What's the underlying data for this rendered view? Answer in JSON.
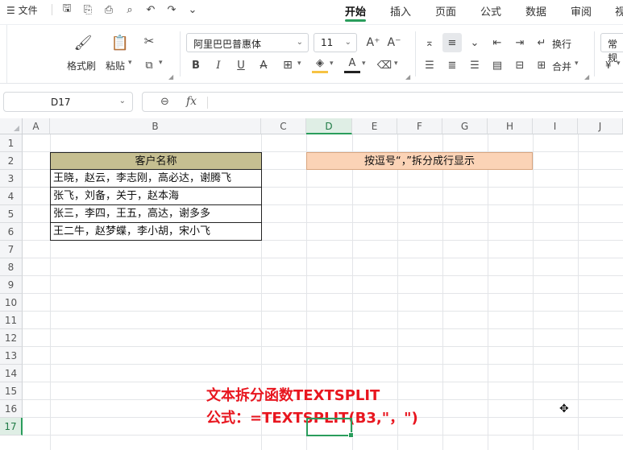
{
  "menu": {
    "file_label": "文件",
    "tabs": [
      "开始",
      "插入",
      "页面",
      "公式",
      "数据",
      "审阅",
      "视"
    ],
    "active_tab": "开始"
  },
  "ribbon": {
    "format_painter": "格式刷",
    "paste": "粘贴",
    "font_name": "阿里巴巴普惠体",
    "font_size": "11",
    "wrap": "换行",
    "merge": "合并",
    "number_format": "常规",
    "currency_symbol": "¥"
  },
  "formula_bar": {
    "cell_ref": "D17",
    "fx": "fx",
    "value": ""
  },
  "grid": {
    "columns": [
      "A",
      "B",
      "C",
      "D",
      "E",
      "F",
      "G",
      "H",
      "I",
      "J"
    ],
    "rows": [
      "1",
      "2",
      "3",
      "4",
      "5",
      "6",
      "7",
      "8",
      "9",
      "10",
      "11",
      "12",
      "13",
      "14",
      "15",
      "16",
      "17"
    ],
    "selected_column": "D",
    "selected_row": "17"
  },
  "table": {
    "header": "客户名称",
    "rows": [
      "王晓，赵云，李志刚，高必达，谢腾飞",
      "张飞，刘备，关于，赵本海",
      "张三，李四，王五，高达，谢多多",
      "王二牛，赵梦蝶，李小胡，宋小飞"
    ]
  },
  "split_label": "按逗号“，”拆分成行显示",
  "note": {
    "line1": "文本拆分函数TEXTSPLIT",
    "line2": "公式：=TEXTSPLIT(B3,\"，\")"
  },
  "colors": {
    "accent": "#2a9d5c",
    "table_header": "#c6bf91",
    "orange_cell": "#fbd3b6",
    "note_red": "#e8161f"
  }
}
